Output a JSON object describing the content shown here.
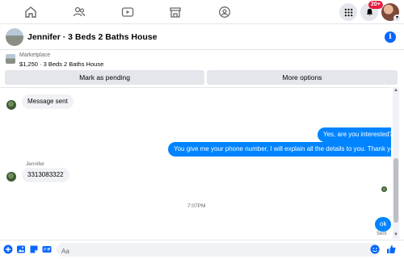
{
  "nav": {
    "icons": [
      "home-icon",
      "friends-icon",
      "watch-icon",
      "marketplace-icon",
      "groups-icon"
    ],
    "menu_icon": "grid-menu-icon",
    "notification_badge": "20+",
    "colors": {
      "accent": "#0866ff",
      "badge": "#e41e3f"
    }
  },
  "chat": {
    "title": "Jennifer · 3 Beds 2 Baths House",
    "info_icon": "i"
  },
  "marketplace": {
    "label": "Marketplace",
    "listing": "$1,250 · 3 Beds 2 Baths House",
    "mark_pending_label": "Mark as pending",
    "more_options_label": "More options"
  },
  "messages": [
    {
      "direction": "in",
      "text": "Message sent"
    },
    {
      "direction": "out",
      "text": "Yes, are you interested?"
    },
    {
      "direction": "out",
      "text": "You give me your phone number, I will explain all the details to you. Thank you."
    },
    {
      "direction": "in",
      "sender": "Jennifer",
      "text": "3313083322"
    },
    {
      "direction": "time",
      "text": "7:07PM"
    },
    {
      "direction": "out",
      "text": "ok",
      "status": "Sent"
    }
  ],
  "composer": {
    "placeholder": "Aa",
    "value": "",
    "icons": [
      "plus-icon",
      "image-icon",
      "sticker-icon",
      "gif-icon",
      "emoji-icon",
      "like-icon"
    ]
  }
}
